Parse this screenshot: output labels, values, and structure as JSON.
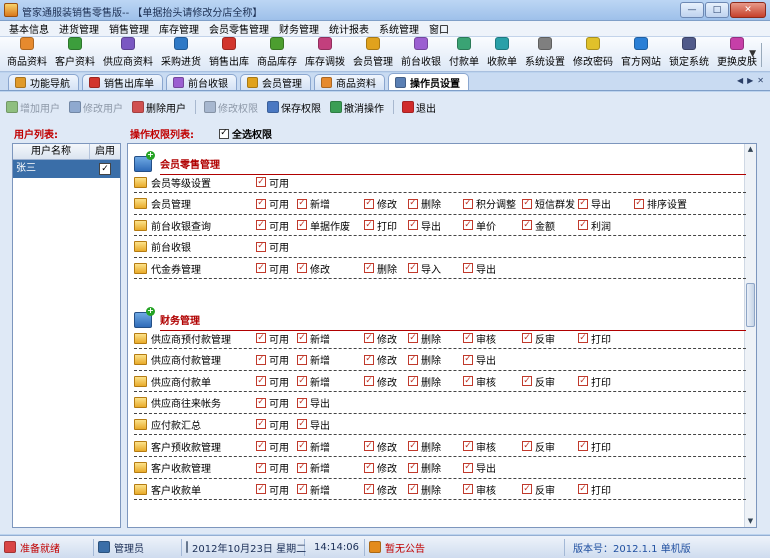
{
  "window": {
    "title": "管家通服装销售零售版-- 【单据抬头请修改分店全称】"
  },
  "menu": [
    "基本信息",
    "进货管理",
    "销售管理",
    "库存管理",
    "会员零售管理",
    "财务管理",
    "统计报表",
    "系统管理",
    "窗口"
  ],
  "toolbar": [
    {
      "label": "商品资料",
      "color": "#e68a2e"
    },
    {
      "label": "客户资料",
      "color": "#3c9e3c"
    },
    {
      "label": "供应商资料",
      "color": "#7a58c2"
    },
    {
      "label": "采购进货",
      "color": "#2f79c6"
    },
    {
      "label": "销售出库",
      "color": "#d2352d"
    },
    {
      "label": "商品库存",
      "color": "#4c9e2f"
    },
    {
      "label": "库存调拨",
      "color": "#c23f7d"
    },
    {
      "label": "会员管理",
      "color": "#e0a21d"
    },
    {
      "label": "前台收银",
      "color": "#9b5fd1"
    },
    {
      "label": "付款单",
      "color": "#3aa374"
    },
    {
      "label": "收款单",
      "color": "#29a0a8"
    },
    {
      "label": "系统设置",
      "color": "#7f7f7f"
    },
    {
      "label": "修改密码",
      "color": "#e0c12a"
    },
    {
      "label": "官方网站",
      "color": "#2a7fd6"
    },
    {
      "label": "锁定系统",
      "color": "#505a8a"
    },
    {
      "label": "更换皮肤",
      "color": "#c63fa8"
    }
  ],
  "tabs": [
    {
      "label": "功能导航",
      "color": "#e09a2a",
      "active": false
    },
    {
      "label": "销售出库单",
      "color": "#d2352d",
      "active": false
    },
    {
      "label": "前台收银",
      "color": "#9b5fd1",
      "active": false
    },
    {
      "label": "会员管理",
      "color": "#e0a21d",
      "active": false
    },
    {
      "label": "商品资料",
      "color": "#e68a2e",
      "active": false
    },
    {
      "label": "操作员设置",
      "color": "#5a7fb3",
      "active": true
    }
  ],
  "actions": [
    {
      "label": "增加用户",
      "enabled": false,
      "color": "#8fbf7f"
    },
    {
      "label": "修改用户",
      "enabled": false,
      "color": "#8fa9cf"
    },
    {
      "label": "删除用户",
      "enabled": true,
      "color": "#d05050"
    },
    {
      "label": "修改权限",
      "enabled": false,
      "color": "#a7b7cf"
    },
    {
      "label": "保存权限",
      "enabled": true,
      "color": "#4a78c2"
    },
    {
      "label": "撤消操作",
      "enabled": true,
      "color": "#3b9e55"
    },
    {
      "label": "退出",
      "enabled": true,
      "color": "#d02b2b"
    }
  ],
  "labels": {
    "user_list": "用户列表:",
    "perm_list": "操作权限列表:",
    "select_all": "全选权限"
  },
  "user_table": {
    "headers": [
      "用户名称",
      "启用"
    ],
    "rows": [
      {
        "name": "张三",
        "enabled": true
      }
    ]
  },
  "sections": [
    {
      "title": "会员零售管理",
      "items": [
        {
          "name": "会员等级设置",
          "perms": [
            "可用"
          ]
        },
        {
          "name": "会员管理",
          "perms": [
            "可用",
            "新增",
            "修改",
            "删除",
            "积分调整",
            "短信群发",
            "导出",
            "排序设置"
          ]
        },
        {
          "name": "前台收银查询",
          "perms": [
            "可用",
            "单据作废",
            "打印",
            "导出",
            "单价",
            "金额",
            "利润"
          ]
        },
        {
          "name": "前台收银",
          "perms": [
            "可用"
          ]
        },
        {
          "name": "代金券管理",
          "perms": [
            "可用",
            "修改",
            "删除",
            "导入",
            "导出"
          ]
        }
      ]
    },
    {
      "title": "财务管理",
      "items": [
        {
          "name": "供应商预付款管理",
          "perms": [
            "可用",
            "新增",
            "修改",
            "删除",
            "审核",
            "反审",
            "打印"
          ]
        },
        {
          "name": "供应商付款管理",
          "perms": [
            "可用",
            "新增",
            "修改",
            "删除",
            "导出"
          ]
        },
        {
          "name": "供应商付款单",
          "perms": [
            "可用",
            "新增",
            "修改",
            "删除",
            "审核",
            "反审",
            "打印"
          ]
        },
        {
          "name": "供应商往来帐务",
          "perms": [
            "可用",
            "导出"
          ]
        },
        {
          "name": "应付款汇总",
          "perms": [
            "可用",
            "导出"
          ]
        },
        {
          "name": "客户预收款管理",
          "perms": [
            "可用",
            "新增",
            "修改",
            "删除",
            "审核",
            "反审",
            "打印"
          ]
        },
        {
          "name": "客户收款管理",
          "perms": [
            "可用",
            "新增",
            "修改",
            "删除",
            "导出"
          ]
        },
        {
          "name": "客户收款单",
          "perms": [
            "可用",
            "新增",
            "修改",
            "删除",
            "审核",
            "反审",
            "打印"
          ]
        }
      ]
    }
  ],
  "status": {
    "ready": "准备就绪",
    "user": "管理员",
    "datetime": "2012年10月23日 星期二",
    "time": "14:14:06",
    "notice": "暂无公告",
    "version": "版本号：2012.1.1 单机版"
  }
}
